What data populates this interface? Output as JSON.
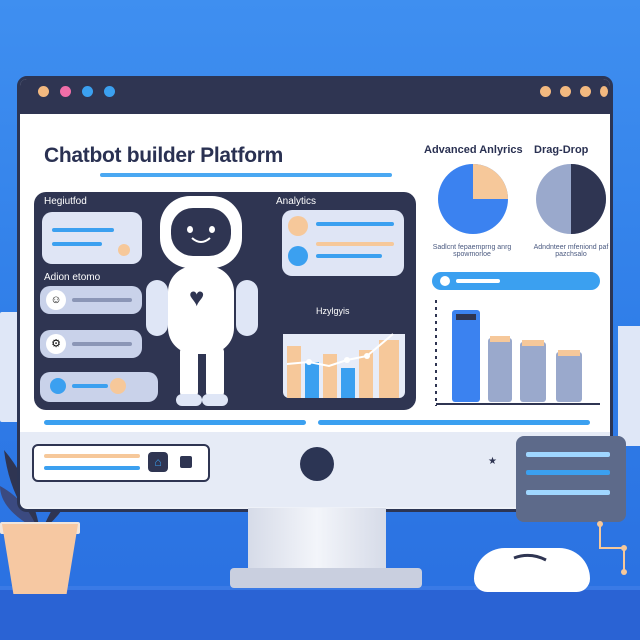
{
  "colors": {
    "accent": "#3ba0f0",
    "dark": "#2f3552",
    "peach": "#f6c89a",
    "background": "#3f8ff0"
  },
  "window": {
    "dots": [
      "#f3b980",
      "#f06ea8",
      "#3ba0f0",
      "#3ba0f0"
    ],
    "right_dots": [
      "#f3b980",
      "#f3b980",
      "#f3b980",
      "#f3b980"
    ]
  },
  "header": {
    "title": "Chatbot builder Platform"
  },
  "panel": {
    "label_top_left": "Hegiutfod",
    "label_analytics": "Analytics",
    "label_mid_left": "Adion etomo",
    "label_chart": "Hzylgyis"
  },
  "right": {
    "advanced_label": "Advanced Anlyrics",
    "dragdrop_label": "Drag-Drop",
    "advanced_caption": "Sadlcnt fepaemprng anrg spowmorloe",
    "dragdrop_caption": "Adndnteer mfeniond paf pazchsalo",
    "pie_advanced_fraction": 0.25,
    "pie_drag_fraction": 0.5
  },
  "icons": [
    "robot-icon",
    "heart-icon",
    "home-icon",
    "star-icon",
    "gear-icon",
    "chat-bubble-icon"
  ]
}
